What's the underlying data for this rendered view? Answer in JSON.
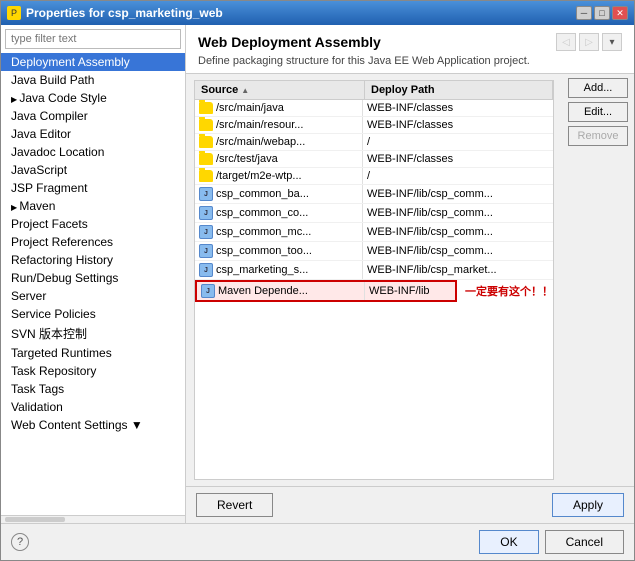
{
  "window": {
    "title": "Properties for csp_marketing_web",
    "title_icon": "P"
  },
  "sidebar": {
    "filter_placeholder": "type filter text",
    "items": [
      {
        "label": "Deployment Assembly",
        "selected": true,
        "indent": 0
      },
      {
        "label": "Java Build Path",
        "indent": 0
      },
      {
        "label": "Java Code Style",
        "indent": 0,
        "arrow": true
      },
      {
        "label": "Java Compiler",
        "indent": 0
      },
      {
        "label": "Java Editor",
        "indent": 0
      },
      {
        "label": "Javadoc Location",
        "indent": 0
      },
      {
        "label": "JavaScript",
        "indent": 0
      },
      {
        "label": "JSP Fragment",
        "indent": 0
      },
      {
        "label": "Maven",
        "indent": 0,
        "arrow": true
      },
      {
        "label": "Project Facets",
        "indent": 0
      },
      {
        "label": "Project References",
        "indent": 0
      },
      {
        "label": "Refactoring History",
        "indent": 0
      },
      {
        "label": "Run/Debug Settings",
        "indent": 0
      },
      {
        "label": "Server",
        "indent": 0
      },
      {
        "label": "Service Policies",
        "indent": 0
      },
      {
        "label": "SVN 版本控制",
        "indent": 0
      },
      {
        "label": "Targeted Runtimes",
        "indent": 0
      },
      {
        "label": "Task Repository",
        "indent": 0
      },
      {
        "label": "Task Tags",
        "indent": 0
      },
      {
        "label": "Validation",
        "indent": 0
      },
      {
        "label": "Web Content Settings",
        "indent": 0
      }
    ]
  },
  "main": {
    "title": "Web Deployment Assembly",
    "description": "Define packaging structure for this Java EE Web Application project.",
    "table": {
      "col_source": "Source",
      "col_deploy": "Deploy Path",
      "rows": [
        {
          "source": "/src/main/java",
          "deploy": "WEB-INF/classes",
          "type": "folder"
        },
        {
          "source": "/src/main/resour...",
          "deploy": "WEB-INF/classes",
          "type": "folder"
        },
        {
          "source": "/src/main/webap...",
          "deploy": "/",
          "type": "folder"
        },
        {
          "source": "/src/test/java",
          "deploy": "WEB-INF/classes",
          "type": "folder"
        },
        {
          "source": "/target/m2e-wtp...",
          "deploy": "/",
          "type": "folder"
        },
        {
          "source": "csp_common_ba...",
          "deploy": "WEB-INF/lib/csp_comm...",
          "type": "jar"
        },
        {
          "source": "csp_common_co...",
          "deploy": "WEB-INF/lib/csp_comm...",
          "type": "jar"
        },
        {
          "source": "csp_common_mc...",
          "deploy": "WEB-INF/lib/csp_comm...",
          "type": "jar"
        },
        {
          "source": "csp_common_too...",
          "deploy": "WEB-INF/lib/csp_comm...",
          "type": "jar"
        },
        {
          "source": "csp_marketing_s...",
          "deploy": "WEB-INF/lib/csp_market...",
          "type": "jar"
        },
        {
          "source": "Maven Depende...",
          "deploy": "WEB-INF/lib",
          "type": "jar",
          "highlighted": true
        }
      ]
    },
    "annotation": "一定要有这个！！",
    "buttons": {
      "add": "Add...",
      "edit": "Edit...",
      "remove": "Remove"
    }
  },
  "bottom": {
    "revert": "Revert",
    "apply": "Apply",
    "ok": "OK",
    "cancel": "Cancel"
  }
}
